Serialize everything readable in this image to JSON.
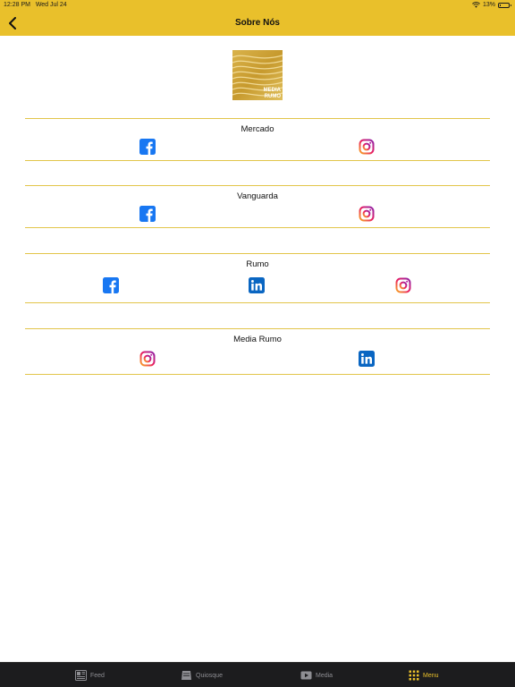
{
  "status_bar": {
    "time": "12:28 PM",
    "date": "Wed Jul 24",
    "battery_percent": "13%",
    "battery_level": 0.13
  },
  "nav": {
    "title": "Sobre Nós",
    "back_icon": "chevron-left-icon"
  },
  "logo": {
    "text_line1": "MEDIA",
    "text_line2": "RUMO",
    "accent": "#c9a032"
  },
  "sections": [
    {
      "title": "Mercado",
      "links": [
        "facebook",
        "instagram"
      ]
    },
    {
      "title": "Vanguarda",
      "links": [
        "facebook",
        "instagram"
      ]
    },
    {
      "title": "Rumo",
      "links": [
        "facebook",
        "linkedin",
        "instagram"
      ]
    },
    {
      "title": "Media Rumo",
      "links": [
        "instagram",
        "linkedin"
      ]
    }
  ],
  "colors": {
    "header": "#e9c02b",
    "divider": "#e2c54a",
    "facebook": "#1877f2",
    "linkedin": "#0a66c2",
    "tab_active": "#e9c02b",
    "tab_inactive": "#8e8e93"
  },
  "tabbar": {
    "items": [
      {
        "label": "Feed",
        "icon": "newspaper-icon",
        "active": false
      },
      {
        "label": "Quiosque",
        "icon": "magazine-icon",
        "active": false
      },
      {
        "label": "Media",
        "icon": "play-icon",
        "active": false
      },
      {
        "label": "Menu",
        "icon": "grid-icon",
        "active": true
      }
    ]
  }
}
